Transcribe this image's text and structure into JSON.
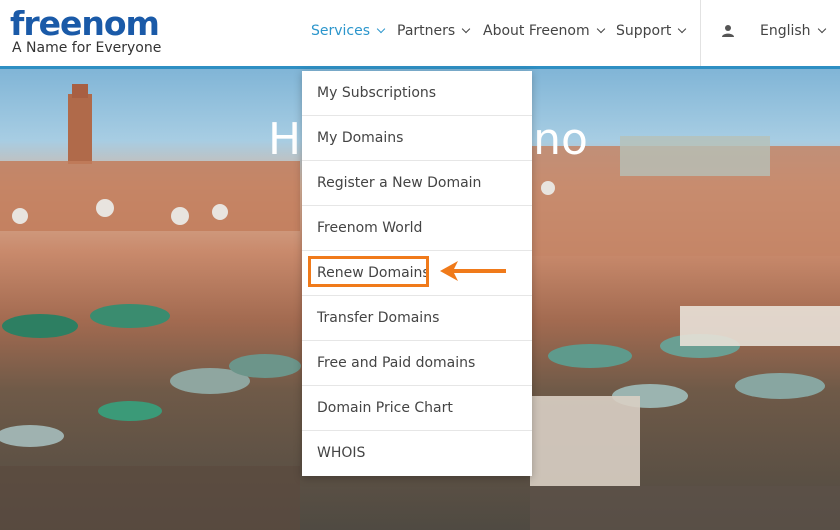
{
  "logo": {
    "text": "freenom",
    "tagline": "A Name for Everyone"
  },
  "nav": {
    "items": [
      {
        "label": "Services",
        "active": true
      },
      {
        "label": "Partners"
      },
      {
        "label": "About Freenom"
      },
      {
        "label": "Support"
      }
    ],
    "user_icon": "user-icon",
    "language": "English"
  },
  "hero": {
    "title_left": "H",
    "title_right": "no"
  },
  "dropdown": {
    "items": [
      "My Subscriptions",
      "My Domains",
      "Register a New Domain",
      "Freenom World",
      "Renew Domains",
      "Transfer Domains",
      "Free and Paid domains",
      "Domain Price Chart",
      "WHOIS"
    ],
    "highlighted": "Renew Domains"
  },
  "colors": {
    "brand": "#1a5aa8",
    "accent": "#2c96cc",
    "highlight": "#f07a1a"
  }
}
